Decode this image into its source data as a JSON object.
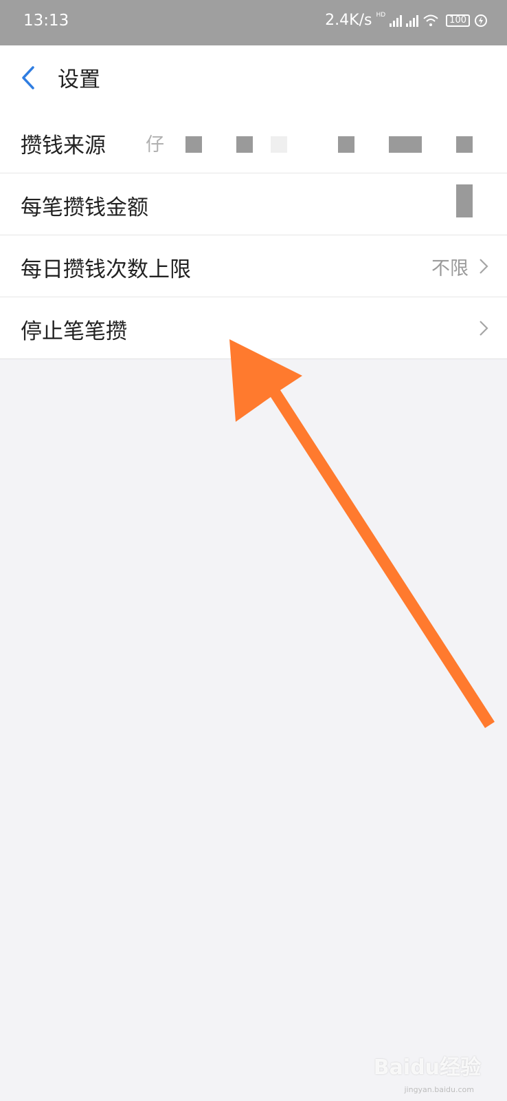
{
  "status_bar": {
    "time": "13:13",
    "net_speed": "2.4K/s",
    "hd_label": "HD",
    "battery": "100"
  },
  "header": {
    "back_icon": "chevron-left-icon",
    "title": "设置"
  },
  "settings": [
    {
      "label": "攒钱来源",
      "value": "仔",
      "redacted": true
    },
    {
      "label": "每笔攒钱金额",
      "value": "",
      "redacted": true
    },
    {
      "label": "每日攒钱次数上限",
      "value": "不限"
    },
    {
      "label": "停止笔笔攒",
      "value": ""
    }
  ],
  "annotation": {
    "color": "#ff7a2e",
    "meaning": "arrow pointing to 停止笔笔攒"
  },
  "watermark": {
    "brand": "Baidu经验",
    "url": "jingyan.baidu.com"
  },
  "colors": {
    "accent": "#2f7de1",
    "background": "#f3f3f6"
  }
}
